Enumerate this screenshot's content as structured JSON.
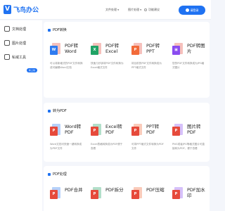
{
  "header": {
    "logo_text": "飞鸟办公",
    "logo_mark": "V",
    "nav": [
      {
        "label": "文件处理"
      },
      {
        "label": "图片处理"
      },
      {
        "label": "功能建议"
      }
    ],
    "login_label": "请登录"
  },
  "sidebar": {
    "items": [
      {
        "label": "文档处理"
      },
      {
        "label": "图片处理"
      },
      {
        "label": "私域工具"
      }
    ],
    "badge": "新上线"
  },
  "sections": [
    {
      "title": "PDF转换",
      "tools": [
        {
          "name": "PDF转Word",
          "desc": "可以将新格式的PDF文件转换成可编辑Word文档",
          "icon": "pdf-to-word-icon",
          "front": "W",
          "front_color": "#2f7bf0",
          "back_color": "#e64a3b"
        },
        {
          "name": "PDF转Excel",
          "desc": "快速几秒钟将PDF文件转换为Excel格式文件",
          "icon": "pdf-to-excel-icon",
          "front": "X",
          "front_color": "#21a366",
          "back_color": "#e64a3b"
        },
        {
          "name": "PDF转PPT",
          "desc": "将目前的PDF文件转换成为PPT格式文件",
          "icon": "pdf-to-ppt-icon",
          "front": "P",
          "front_color": "#f26b3a",
          "back_color": "#e64a3b"
        },
        {
          "name": "PDF转图片",
          "desc": "您的PDF文件转换成为JPG格式图片",
          "icon": "pdf-to-image-icon",
          "front": "▣",
          "front_color": "#8a4cf0",
          "back_color": "#e64a3b"
        }
      ]
    },
    {
      "title": "转为PDF",
      "tools": [
        {
          "name": "Word转PDF",
          "desc": "Word文档可快速一键转换成为PDF文件",
          "icon": "word-to-pdf-icon",
          "front": "P",
          "front_color": "#e64a3b",
          "back_color": "#2f7bf0"
        },
        {
          "name": "Excel转PDF",
          "desc": "Excel表格转换成为PDF便于查看",
          "icon": "excel-to-pdf-icon",
          "front": "P",
          "front_color": "#e64a3b",
          "back_color": "#21a366"
        },
        {
          "name": "PPT转PDF",
          "desc": "可将PPT格式文件转换为PDF文件",
          "icon": "ppt-to-pdf-icon",
          "front": "P",
          "front_color": "#e64a3b",
          "back_color": "#f26b3a"
        },
        {
          "name": "图片转PDF",
          "desc": "PNG或者JPG等格式图片可直接转为PDF，便于查看",
          "icon": "image-to-pdf-icon",
          "front": "P",
          "front_color": "#e64a3b",
          "back_color": "#8a4cf0"
        }
      ]
    },
    {
      "title": "PDF处理",
      "tools": [
        {
          "name": "PDF合并",
          "desc": "",
          "icon": "pdf-merge-icon",
          "front": "P",
          "front_color": "#e64a3b",
          "back_color": "#2f7bf0"
        },
        {
          "name": "PDF拆分",
          "desc": "",
          "icon": "pdf-split-icon",
          "front": "P",
          "front_color": "#e64a3b",
          "back_color": "#21a366"
        },
        {
          "name": "PDF压缩",
          "desc": "",
          "icon": "pdf-compress-icon",
          "front": "P",
          "front_color": "#e64a3b",
          "back_color": "#f26b3a"
        },
        {
          "name": "PDF加水印",
          "desc": "",
          "icon": "pdf-watermark-icon",
          "front": "P",
          "front_color": "#e64a3b",
          "back_color": "#8a4cf0"
        }
      ]
    }
  ]
}
